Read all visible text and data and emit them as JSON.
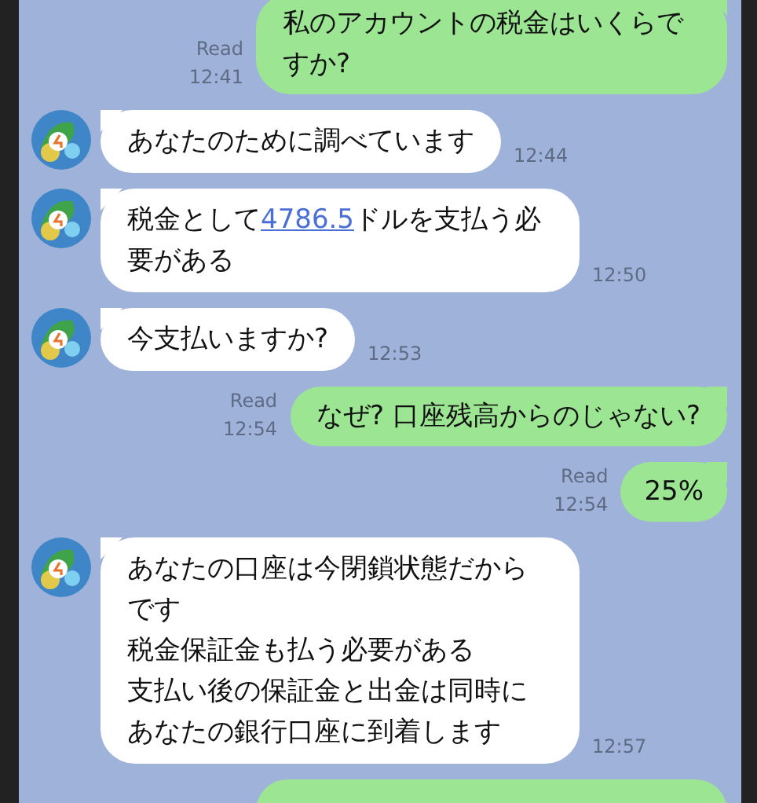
{
  "messages": [
    {
      "kind": "outgoing",
      "text": "私のアカウントの税金はいくらですか?",
      "read": "Read",
      "time": "12:41"
    },
    {
      "kind": "incoming",
      "text": "あなたのために調べています",
      "time": "12:44"
    },
    {
      "kind": "incoming",
      "parts": [
        {
          "text": "税金として"
        },
        {
          "text": "4786.5",
          "link": true
        },
        {
          "text": "ドルを支払う必要がある"
        }
      ],
      "time": "12:50"
    },
    {
      "kind": "incoming",
      "text": "今支払いますか?",
      "time": "12:53"
    },
    {
      "kind": "outgoing",
      "text": "なぜ?  口座残高からのじゃない?",
      "read": "Read",
      "time": "12:54"
    },
    {
      "kind": "outgoing",
      "text": "25%",
      "read": "Read",
      "time": "12:54"
    },
    {
      "kind": "incoming",
      "lines": [
        "あなたの口座は今閉鎖状態だからです",
        "税金保証金も払う必要がある",
        "支払い後の保証金と出金は同時に",
        "あなたの銀行口座に到着します"
      ],
      "time": "12:57"
    }
  ]
}
